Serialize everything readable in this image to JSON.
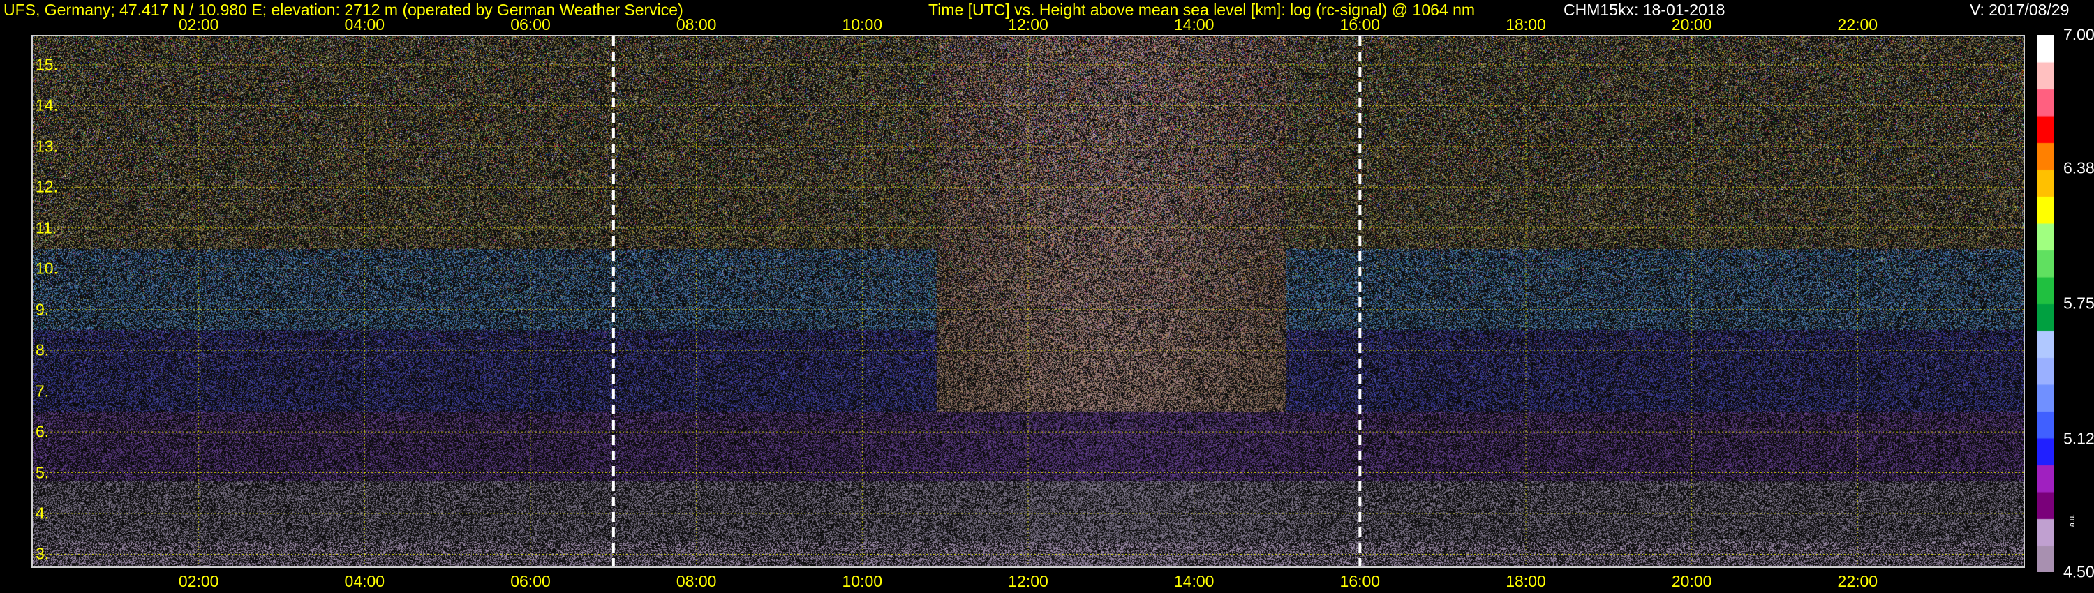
{
  "header": {
    "station": "UFS, Germany; 47.417 N / 10.980 E; elevation: 2712 m  (operated by German Weather Service)",
    "axis_title": "Time [UTC] vs. Height above mean sea level [km]: log (rc-signal) @ 1064 nm",
    "instrument_date": "CHM15kx: 18-01-2018",
    "version": "V: 2017/08/29"
  },
  "chart_data": {
    "type": "heatmap",
    "title": "Time [UTC] vs. Height above mean sea level [km]: log (rc-signal) @ 1064 nm",
    "x_range_hours": [
      0.0,
      24.0
    ],
    "x_ticks": [
      "02:00",
      "04:00",
      "06:00",
      "08:00",
      "10:00",
      "12:00",
      "14:00",
      "16:00",
      "18:00",
      "20:00",
      "22:00"
    ],
    "x_tick_hours": [
      2,
      4,
      6,
      8,
      10,
      12,
      14,
      16,
      18,
      20,
      22
    ],
    "y_range_km": [
      2.7,
      15.7
    ],
    "y_ticks": [
      "3.",
      "4.",
      "5.",
      "6.",
      "7.",
      "8.",
      "9.",
      "10.",
      "11.",
      "12.",
      "13.",
      "14.",
      "15."
    ],
    "y_tick_values": [
      3,
      4,
      5,
      6,
      7,
      8,
      9,
      10,
      11,
      12,
      13,
      14,
      15
    ],
    "grid": true,
    "markers_dashed_hours": [
      7.0,
      16.0
    ],
    "colorbar": {
      "range": [
        4.5,
        7.0
      ],
      "ticks": [
        "7.00",
        "6.38",
        "5.75",
        "5.12",
        "4.50"
      ],
      "tick_values": [
        7.0,
        6.38,
        5.75,
        5.12,
        4.5
      ],
      "unit_label": "a.u."
    }
  },
  "colors": {
    "text_header": "#ffff00",
    "grid": "#d8d800",
    "background": "#000000",
    "colormap": [
      "#a890b0",
      "#c0a0d0",
      "#7a007a",
      "#a020c0",
      "#2020ff",
      "#4060ff",
      "#7090ff",
      "#9ab0ff",
      "#b0c8ff",
      "#00a040",
      "#20c040",
      "#60e060",
      "#a0ff80",
      "#ffff00",
      "#ffc000",
      "#ff8000",
      "#ff0000",
      "#ff6080",
      "#ffc0c0",
      "#ffffff"
    ]
  }
}
